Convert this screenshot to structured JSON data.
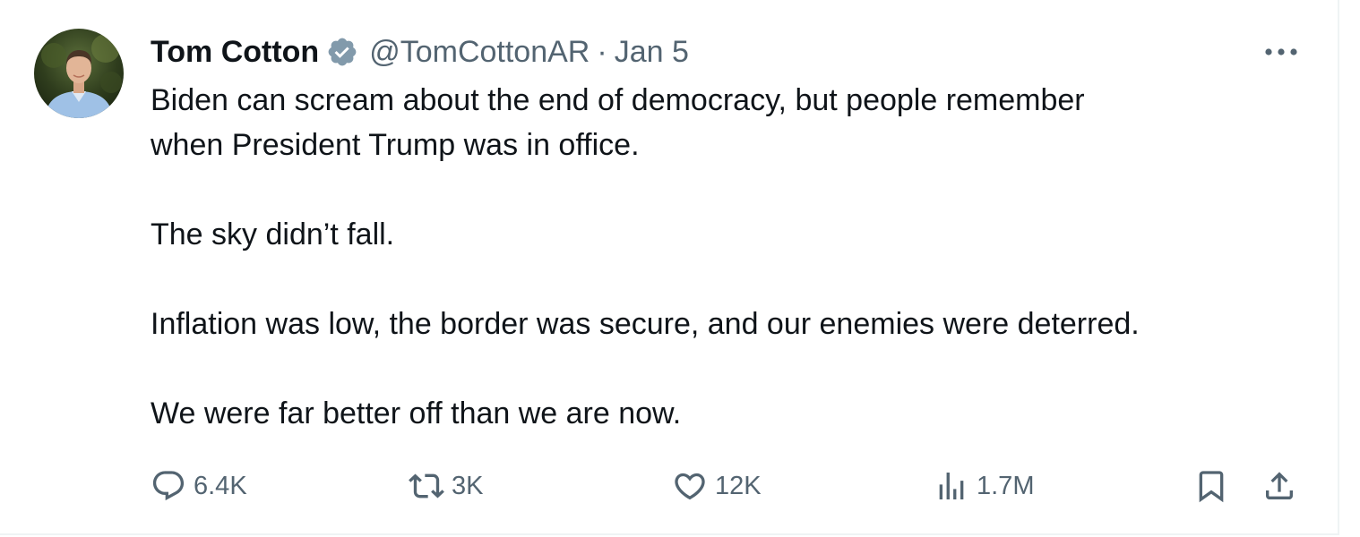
{
  "tweet": {
    "author_name": "Tom Cotton",
    "handle": "@TomCottonAR",
    "separator": "·",
    "date": "Jan 5",
    "verified_icon": "verified-badge-icon",
    "text": {
      "line1": "Biden can scream about the end of democracy, but people remember",
      "line2": "when President Trump was in office.",
      "para2": "The sky didn’t fall.",
      "para3": "Inflation was low, the border was secure, and our enemies were deterred.",
      "para4": "We were far better off than we are now."
    },
    "more_icon": "more-horizontal-icon"
  },
  "actions": {
    "replies": {
      "icon": "reply-icon",
      "count": "6.4K"
    },
    "reposts": {
      "icon": "repost-icon",
      "count": "3K"
    },
    "likes": {
      "icon": "heart-icon",
      "count": "12K"
    },
    "views": {
      "icon": "views-chart-icon",
      "count": "1.7M"
    },
    "bookmark": {
      "icon": "bookmark-icon"
    },
    "share": {
      "icon": "share-icon"
    }
  },
  "colors": {
    "text_primary": "#0f1419",
    "text_secondary": "#536471",
    "verified_badge": "#829aab",
    "border": "#eff3f4"
  }
}
